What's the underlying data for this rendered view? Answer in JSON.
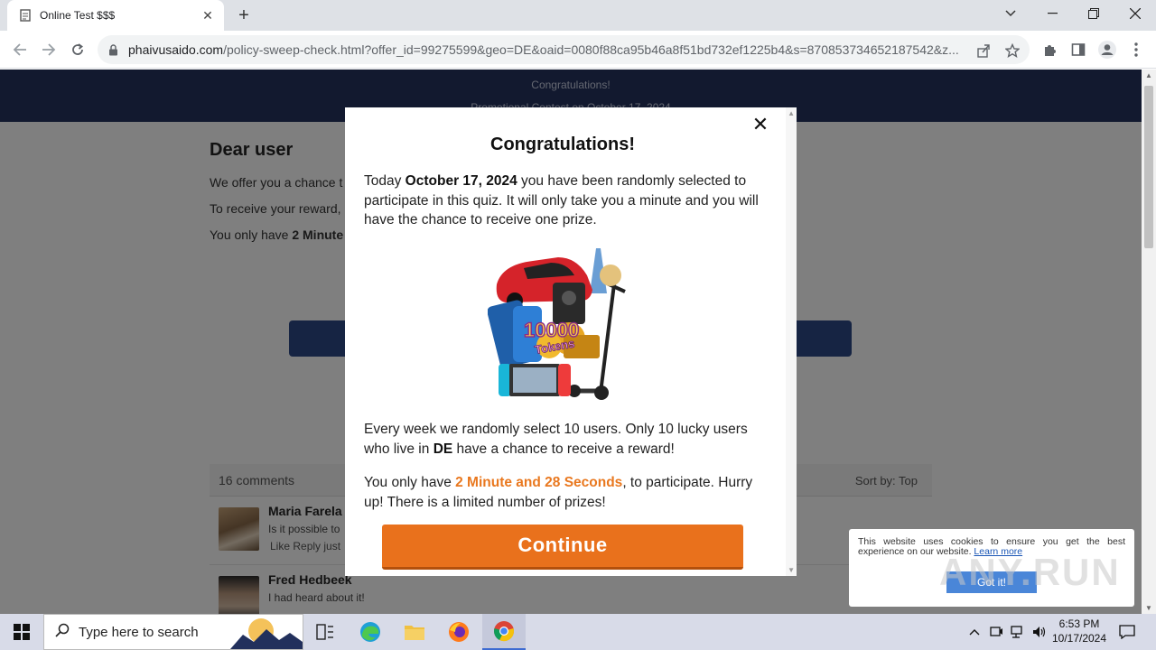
{
  "browser": {
    "tab_title": "Online Test $$$",
    "url_host": "phaivusaido.com",
    "url_path": "/policy-sweep-check.html?offer_id=99275599&geo=DE&oaid=0080f88ca95b46a8f51bd732ef1225b4&s=870853734652187542&z..."
  },
  "page": {
    "hero_line1": "Congratulations!",
    "hero_line2": "Promotional Contest on October 17, 2024",
    "greeting": "Dear user",
    "para1": "We offer you a chance t",
    "para2": "To receive your reward,",
    "para3_prefix": "You only have ",
    "para3_bold": "2 Minute",
    "comments_count": "16 comments",
    "sort_label": "Sort by:  Top",
    "comments": [
      {
        "name": "Maria Farela",
        "text": "Is it possible to",
        "meta": "Like Reply  just"
      },
      {
        "name": "Fred Hedbeek",
        "text": "I had heard about it!",
        "meta": ""
      }
    ]
  },
  "modal": {
    "title": "Congratulations!",
    "intro_prefix": "Today ",
    "intro_date": "October 17, 2024",
    "intro_suffix": " you have been randomly selected to participate in this quiz. It will only take you a minute and you will have the chance to receive one prize.",
    "weekly_prefix": "Every week we randomly select 10 users. Only 10 lucky users who live in ",
    "weekly_country": "DE",
    "weekly_suffix": " have a chance to receive a reward!",
    "timer_prefix": "You only have ",
    "timer_value": "2 Minute and 28 Seconds",
    "timer_suffix": ", to participate. Hurry up! There is a limited number of prizes!",
    "continue_label": "Continue",
    "prize_tokens_label": "10000 Tokens"
  },
  "cookie": {
    "text": "This website uses cookies to ensure you get the best experience on our website.",
    "link": "Learn more",
    "button": "Got it!"
  },
  "watermark": "ANY.RUN",
  "taskbar": {
    "search_placeholder": "Type here to search",
    "time": "6:53 PM",
    "date": "10/17/2024"
  },
  "colors": {
    "accent_orange": "#e9711c",
    "hero_navy": "#24325e",
    "page_button_blue": "#2d4886"
  }
}
